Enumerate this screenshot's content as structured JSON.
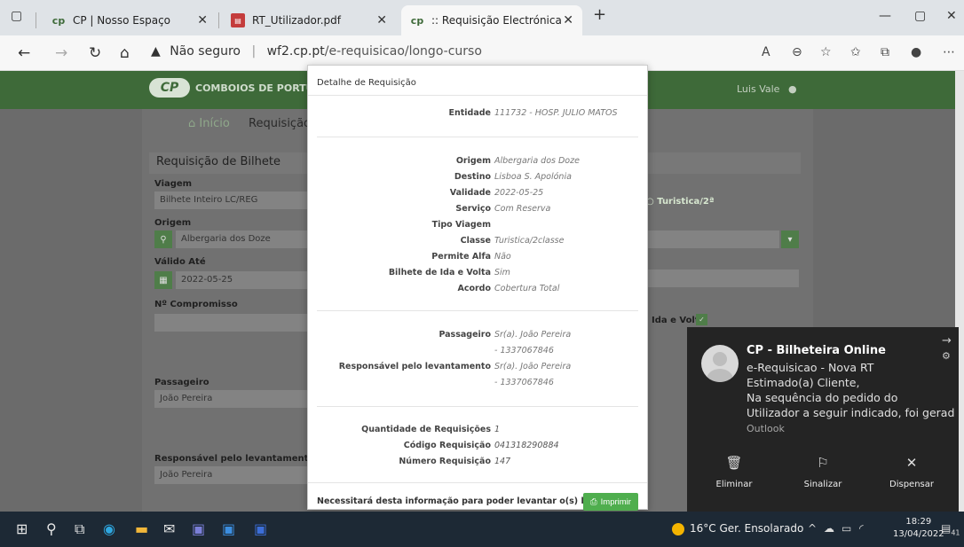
{
  "browser": {
    "tabs": [
      {
        "title": "CP | Nosso Espaço",
        "icon": "cp-logo-icon"
      },
      {
        "title": "RT_Utilizador.pdf",
        "icon": "pdf-icon"
      },
      {
        "title": ":: Requisição Electrónica de Tran:",
        "icon": "cp-logo-icon"
      }
    ],
    "new_tab": "+",
    "insecure_label": "Não seguro",
    "url_host": "wf2.cp.pt",
    "url_path": "/e-requisicao/longo-curso"
  },
  "page": {
    "logo_text": "COMBOIOS DE PORTUGAL",
    "logo_mark": "CP",
    "user_name": "Luis Vale",
    "breadcrumb_home": "Início",
    "breadcrumb_current": "Requisição de",
    "section_title": "Requisição de Bilhete",
    "fields": {
      "viagem_label": "Viagem",
      "viagem_value": "Bilhete Inteiro LC/REG",
      "origem_label": "Origem",
      "origem_value": "Albergaria dos Doze",
      "valido_label": "Válido Até",
      "valido_value": "2022-05-25",
      "compromisso_label": "Nº Compromisso",
      "passageiro_label": "Passageiro",
      "passageiro_value": "João Pereira",
      "responsavel_label": "Responsável pelo levantamento",
      "responsavel_value": "João Pereira",
      "turistica_label": "Turistica/2ª",
      "ida_volta_label": "Ida e Volta"
    }
  },
  "modal": {
    "title": "Detalhe de Requisição",
    "entidade": {
      "label": "Entidade",
      "value": "111732 - HOSP. JULIO MATOS"
    },
    "details": [
      {
        "label": "Origem",
        "value": "Albergaria dos Doze"
      },
      {
        "label": "Destino",
        "value": "Lisboa S. Apolónia"
      },
      {
        "label": "Validade",
        "value": "2022-05-25"
      },
      {
        "label": "Serviço",
        "value": "Com Reserva"
      },
      {
        "label": "Tipo Viagem",
        "value": ""
      },
      {
        "label": "Classe",
        "value": "Turistica/2classe"
      },
      {
        "label": "Permite Alfa",
        "value": "Não"
      },
      {
        "label": "Bilhete de Ida e Volta",
        "value": "Sim"
      },
      {
        "label": "Acordo",
        "value": "Cobertura Total"
      }
    ],
    "passageiro": {
      "label": "Passageiro",
      "value": "Sr(a). João Pereira",
      "value2": "- 1337067846"
    },
    "responsavel": {
      "label": "Responsável pelo levantamento",
      "value": "Sr(a). João Pereira",
      "value2": "- 1337067846"
    },
    "totals": [
      {
        "label": "Quantidade de Requisições",
        "value": "1"
      },
      {
        "label": "Código Requisição",
        "value": "041318290884"
      },
      {
        "label": "Número Requisição",
        "value": "147"
      }
    ],
    "footer_text": "Necessitará desta informação para poder levantar o(s) bilhete(s).",
    "print_label": "Imprimir"
  },
  "notification": {
    "title": "CP - Bilheteira Online",
    "lines": [
      "e-Requisicao - Nova RT",
      "Estimado(a) Cliente,",
      "Na sequência do pedido do",
      "Utilizador a seguir indicado, foi gerad"
    ],
    "source": "Outlook",
    "actions": [
      {
        "label": "Eliminar",
        "icon": "trash-icon"
      },
      {
        "label": "Sinalizar",
        "icon": "flag-icon"
      },
      {
        "label": "Dispensar",
        "icon": "close-icon"
      }
    ]
  },
  "taskbar": {
    "weather": "16°C Ger. Ensolarado",
    "time": "18:29",
    "date": "13/04/2022",
    "notif_count": "41"
  }
}
